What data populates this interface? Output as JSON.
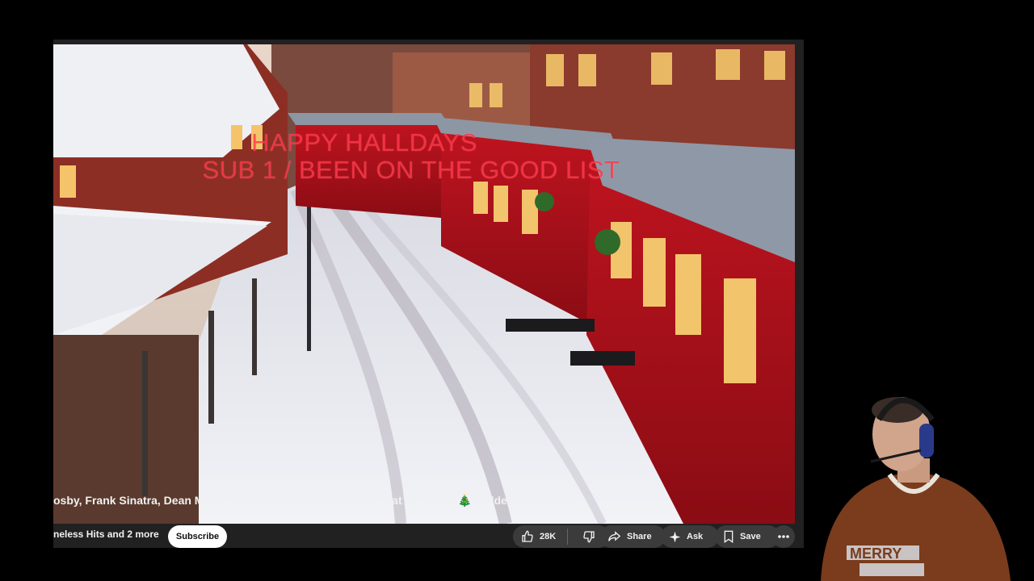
{
  "overlay": {
    "line1": "HAPPY HALLDAYS",
    "line2": "SUB 1 / BEEN ON THE GOOD LIST"
  },
  "video": {
    "title": "osby, Frank Sinatra, Dean Martin, Gene Autry, Andy Williams, Nat King Cole🎄 Golden Christmas",
    "channel": "neless Hits and 2 more"
  },
  "actions": {
    "subscribe": "Subscribe",
    "like_count": "28K",
    "share": "Share",
    "ask": "Ask",
    "save": "Save"
  },
  "icons": {
    "like": "thumbs-up-icon",
    "dislike": "thumbs-down-icon",
    "share": "share-arrow-icon",
    "ask": "sparkle-icon",
    "save": "bookmark-icon",
    "more": "more-horizontal-icon"
  },
  "colors": {
    "background": "#000000",
    "panel": "#212121",
    "pill": "#3b3b3b",
    "overlay_text": "#ff2a3c",
    "train_red": "#b3101d"
  },
  "webcam": {
    "shirt_text": "MERRY"
  }
}
